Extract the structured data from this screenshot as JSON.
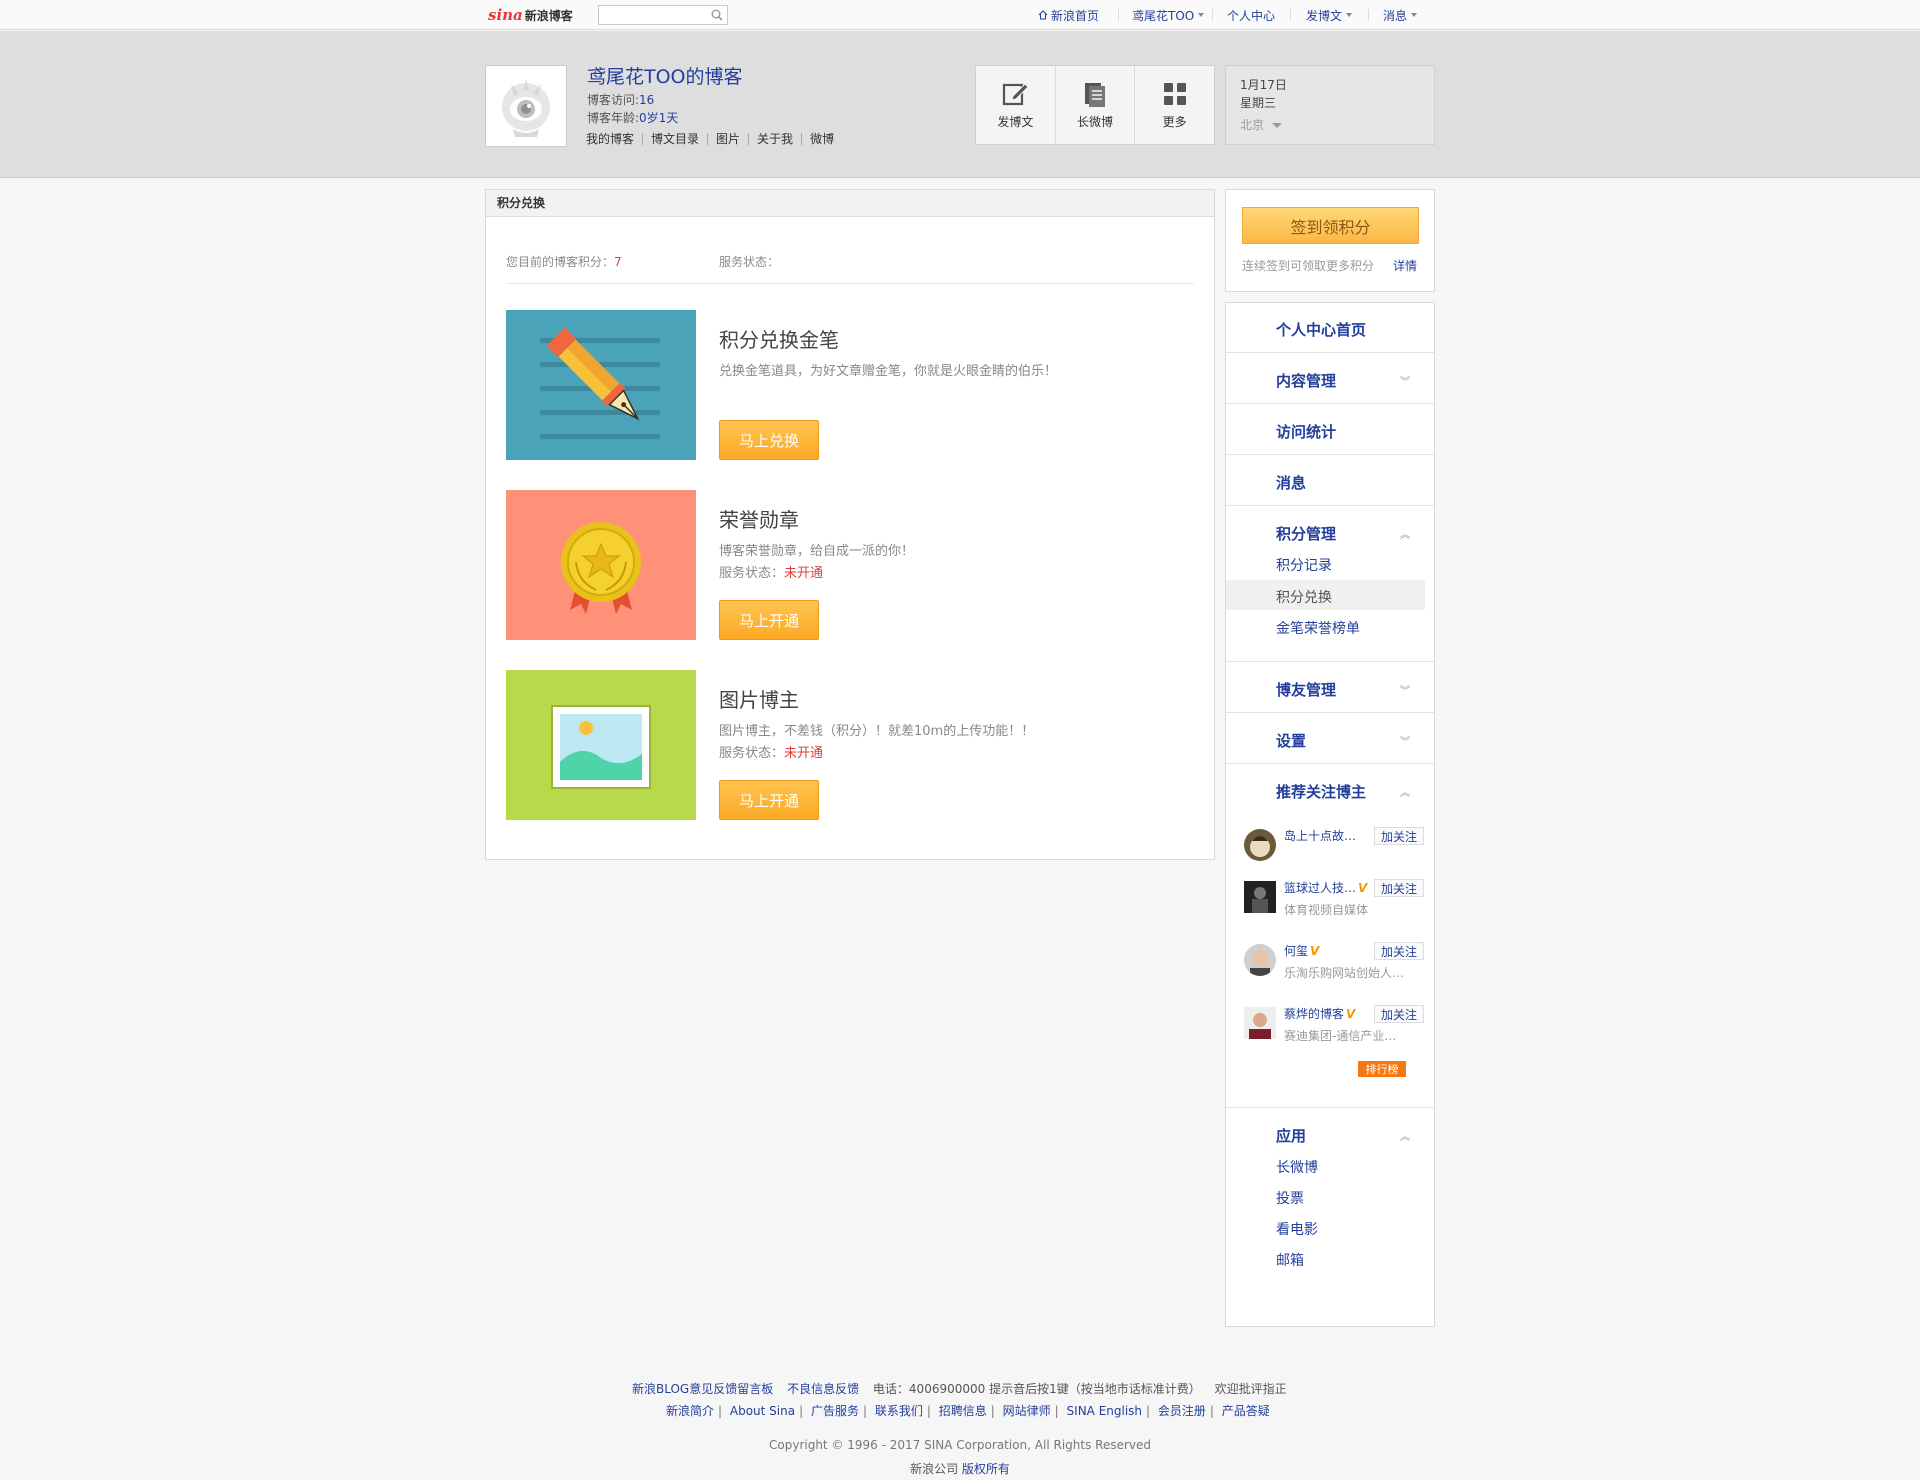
{
  "topbar": {
    "logo_sina": "sina",
    "logo_blog": "新浪博客",
    "search_placeholder": "",
    "nav": {
      "home": "新浪首页",
      "user": "鸢尾花TOO",
      "center": "个人中心",
      "post": "发博文",
      "msg": "消息"
    }
  },
  "profile": {
    "title": "鸢尾花TOO的博客",
    "visits_label": "博客访问:",
    "visits": "16",
    "age_label": "博客年龄:",
    "age": "0岁1天",
    "nav": [
      "我的博客",
      "博文目录",
      "图片",
      "关于我",
      "微博"
    ]
  },
  "tools": {
    "post": "发博文",
    "longweibo": "长微博",
    "more": "更多"
  },
  "date": {
    "day": "1月17日",
    "weekday": "星期三",
    "city": "北京"
  },
  "main": {
    "header": "积分兑换",
    "score_label": "您目前的博客积分：",
    "score": "7",
    "service_label": "服务状态：",
    "features": [
      {
        "title": "积分兑换金笔",
        "desc": "兑换金笔道具，为好文章赠金笔，你就是火眼金睛的伯乐！",
        "status_label": "",
        "status": "",
        "button": "马上兑换"
      },
      {
        "title": "荣誉勋章",
        "desc": "博客荣誉勋章，给自成一派的你！",
        "status_label": "服务状态：",
        "status": "未开通",
        "button": "马上开通"
      },
      {
        "title": "图片博主",
        "desc": "图片博主，不差钱（积分）！就差10m的上传功能！！",
        "status_label": "服务状态：",
        "status": "未开通",
        "button": "马上开通"
      }
    ]
  },
  "sign": {
    "button": "签到领积分",
    "tip": "连续签到可领取更多积分",
    "detail": "详情"
  },
  "menu": {
    "home": "个人中心首页",
    "content": "内容管理",
    "stats": "访问统计",
    "messages": "消息",
    "points": "积分管理",
    "points_sub": [
      "积分记录",
      "积分兑换",
      "金笔荣誉榜单"
    ],
    "friends": "博友管理",
    "settings": "设置",
    "recommend": "推荐关注博主",
    "recommend_list": [
      {
        "name": "岛上十点故…",
        "desc": "",
        "follow": "加关注"
      },
      {
        "name": "篮球过人技…",
        "desc": "体育视频自媒体",
        "follow": "加关注"
      },
      {
        "name": "何玺",
        "desc": "乐淘乐购网站创始人…",
        "follow": "加关注"
      },
      {
        "name": "蔡烨的博客",
        "desc": "赛迪集团-通信产业…",
        "follow": "加关注"
      }
    ],
    "rank": "排行榜",
    "apps": "应用",
    "apps_sub": [
      "长微博",
      "投票",
      "看电影",
      "邮箱"
    ]
  },
  "footer": {
    "line1": [
      "新浪BLOG意见反馈留言板",
      "不良信息反馈",
      "电话：4006900000 提示音后按1键（按当地市话标准计费）",
      "欢迎批评指正"
    ],
    "line2": [
      "新浪简介",
      "About Sina",
      "广告服务",
      "联系我们",
      "招聘信息",
      "网站律师",
      "SINA English",
      "会员注册",
      "产品答疑"
    ],
    "copyright": "Copyright © 1996 - 2017 SINA Corporation, All Rights Reserved",
    "company": "新浪公司",
    "rights": "版权所有"
  },
  "colors": {
    "link": "#233f9b",
    "accent_orange": "#fba925",
    "alert_red": "#e23a3a",
    "pen_bg": "#4aa3b8",
    "medal_bg": "#ff9178",
    "photo_bg": "#b8d94a"
  }
}
